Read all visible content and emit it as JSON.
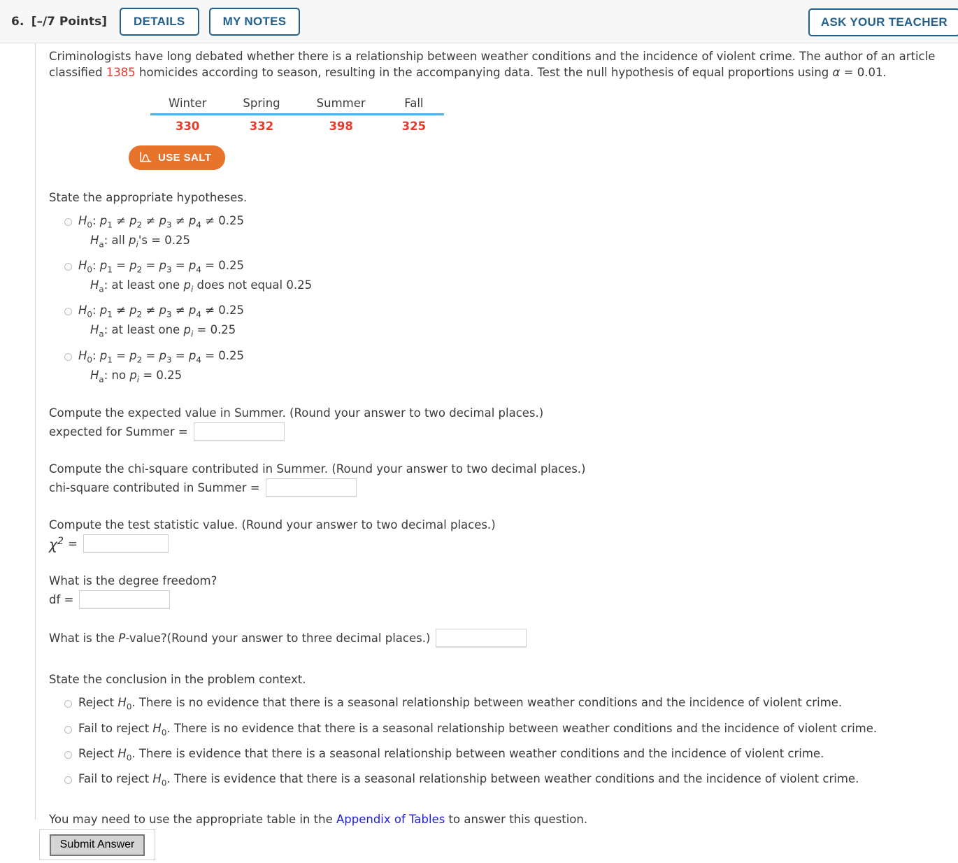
{
  "header": {
    "number": "6.",
    "points": "[–/7 Points]",
    "details_label": "DETAILS",
    "notes_label": "MY NOTES",
    "ask_label": "ASK YOUR TEACHER"
  },
  "prompt": {
    "part1": "Criminologists have long debated whether there is a relationship between weather conditions and the incidence of violent crime. The author of an article classified ",
    "count": "1385",
    "part2": " homicides according to season, resulting in the accompanying data. Test the null hypothesis of equal proportions using ",
    "alpha_sym": "α",
    "part3": " = 0.01."
  },
  "table": {
    "headers": [
      "Winter",
      "Spring",
      "Summer",
      "Fall"
    ],
    "values": [
      "330",
      "332",
      "398",
      "325"
    ]
  },
  "salt": {
    "label": "USE SALT",
    "icon": "distribution-curve-icon",
    "color": "#e8742c"
  },
  "hypotheses": {
    "heading": "State the appropriate hypotheses.",
    "options": [
      {
        "null": "H0: p1 ≠ p2 ≠ p3 ≠ p4 ≠ 0.25",
        "alt": "Ha: all pi's = 0.25",
        "alt_prefix": "all ",
        "alt_suffix": "'s = 0.25",
        "rel": "≠",
        "last": "0.25"
      },
      {
        "null": "H0: p1 = p2 = p3 = p4 = 0.25",
        "alt": "Ha: at least one pi does not equal 0.25",
        "alt_prefix": "at least one ",
        "alt_suffix": " does not equal 0.25",
        "rel": "=",
        "last": "0.25"
      },
      {
        "null": "H0: p1 ≠ p2 ≠ p3 ≠ p4 ≠ 0.25",
        "alt": "Ha: at least one pi = 0.25",
        "alt_prefix": "at least one ",
        "alt_suffix": " = 0.25",
        "rel": "≠",
        "last": "0.25"
      },
      {
        "null": "H0: p1 = p2 = p3 = p4 = 0.25",
        "alt": "Ha: no pi = 0.25",
        "alt_prefix": "no ",
        "alt_suffix": " = 0.25",
        "rel": "=",
        "last": "0.25"
      }
    ]
  },
  "expected": {
    "question": "Compute the expected value in Summer. (Round your answer to two decimal places.)",
    "label": "expected for Summer =",
    "value": "",
    "placeholder": ""
  },
  "chisq_contrib": {
    "question": "Compute the chi-square contributed in Summer. (Round your answer to two decimal places.)",
    "label": "chi-square contributed in Summer =",
    "value": "",
    "placeholder": ""
  },
  "test_statistic": {
    "question": "Compute the test statistic value. (Round your answer to two decimal places.)",
    "symbol": "χ",
    "exponent": "2",
    "equals": "=",
    "value": "",
    "placeholder": ""
  },
  "degrees_freedom": {
    "question": "What is the degree freedom?",
    "label": "df =",
    "value": "",
    "placeholder": ""
  },
  "pvalue": {
    "question_a": "What is the ",
    "question_p": "P",
    "question_b": "-value?(Round your answer to three decimal places.)",
    "value": "",
    "placeholder": ""
  },
  "conclusion": {
    "heading": "State the conclusion in the problem context.",
    "options": [
      {
        "lead": "Reject ",
        "h": "H",
        "sub": "0",
        "tail": ". There is no evidence that there is a seasonal relationship between weather conditions and the incidence of violent crime."
      },
      {
        "lead": "Fail to reject ",
        "h": "H",
        "sub": "0",
        "tail": ". There is no evidence that there is a seasonal relationship between weather conditions and the incidence of violent crime."
      },
      {
        "lead": "Reject ",
        "h": "H",
        "sub": "0",
        "tail": ". There is evidence that there is a seasonal relationship between weather conditions and the incidence of violent crime."
      },
      {
        "lead": "Fail to reject ",
        "h": "H",
        "sub": "0",
        "tail": ". There is evidence that there is a seasonal relationship between weather conditions and the incidence of violent crime."
      }
    ]
  },
  "appendix": {
    "before": "You may need to use the appropriate table in the ",
    "link": "Appendix of Tables",
    "after": " to answer this question."
  },
  "footer": {
    "submit_label": "Submit Answer"
  }
}
